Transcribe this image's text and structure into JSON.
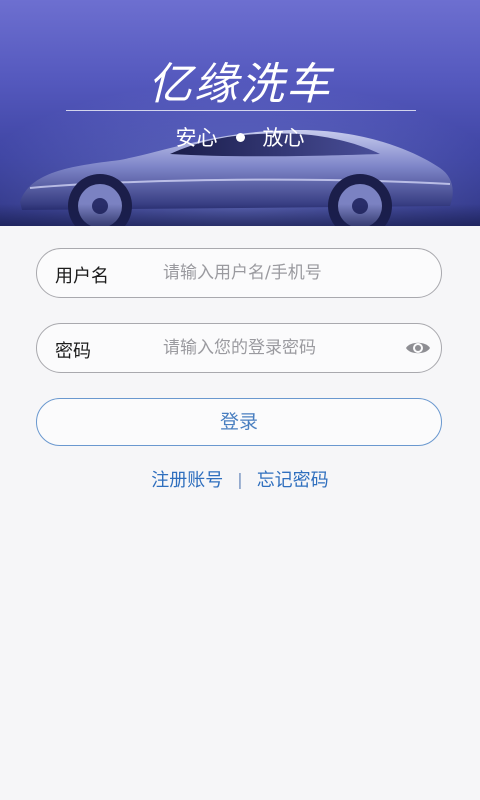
{
  "header": {
    "app_title": "亿缘洗车",
    "slogan_left": "安心",
    "slogan_right": "放心"
  },
  "form": {
    "username": {
      "label": "用户名",
      "placeholder": "请输入用户名/手机号",
      "value": ""
    },
    "password": {
      "label": "密码",
      "placeholder": "请输入您的登录密码",
      "value": ""
    },
    "login_label": "登录"
  },
  "links": {
    "register": "注册账号",
    "separator": "|",
    "forgot_password": "忘记密码"
  },
  "colors": {
    "accent": "#4a7fc0",
    "link": "#2f6fbe",
    "hero_top": "#6d6fd0",
    "hero_bottom": "#2c3280"
  },
  "icons": {
    "password_visibility": "eye-icon"
  }
}
